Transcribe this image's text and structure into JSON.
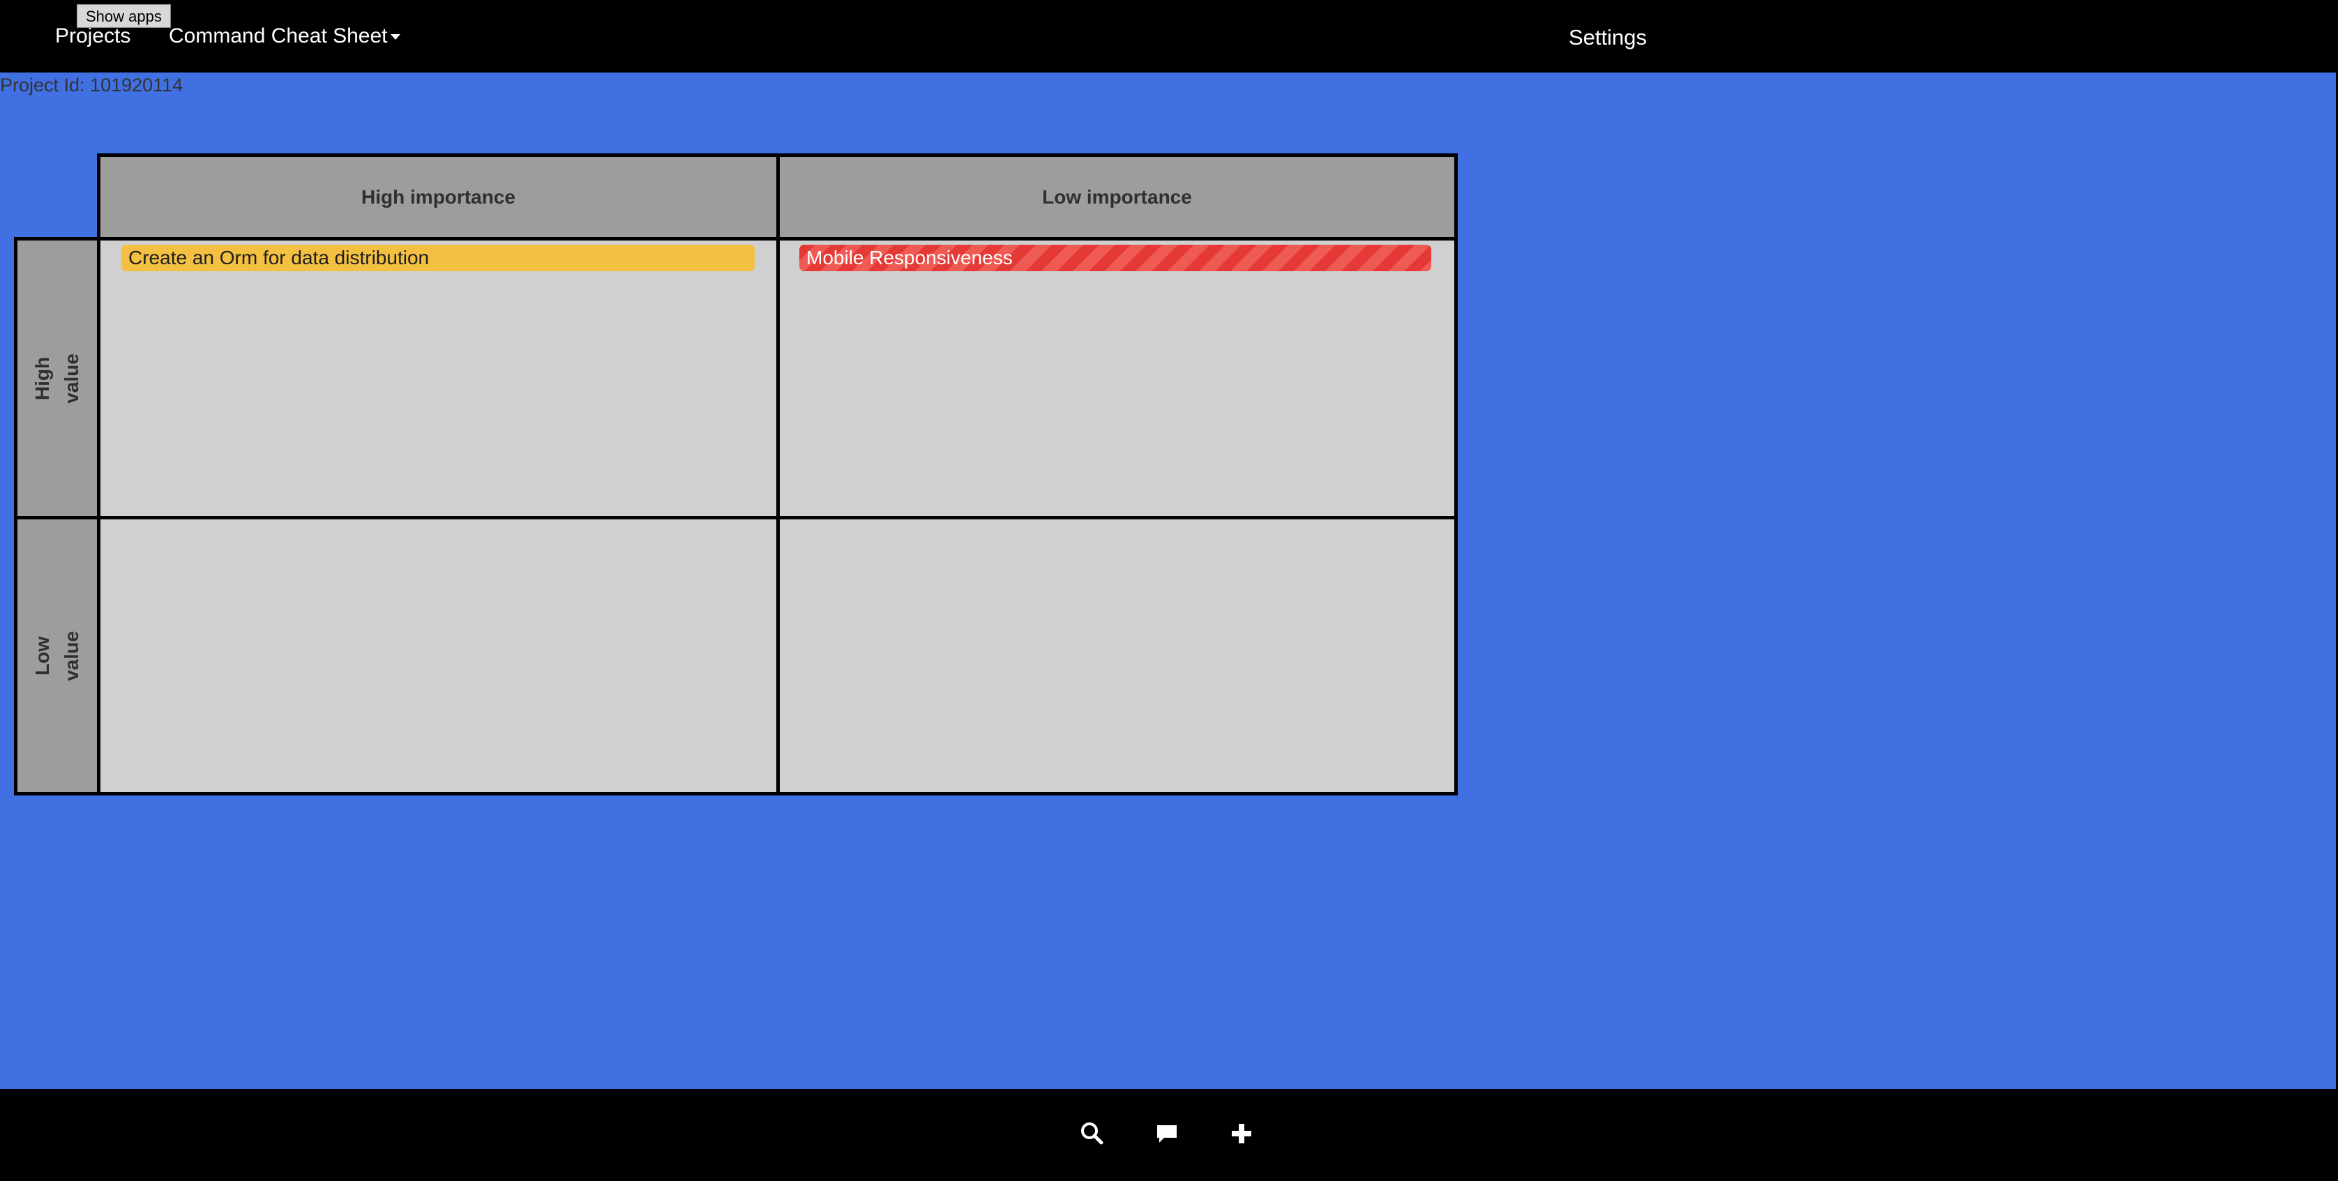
{
  "topbar": {
    "show_apps_label": "Show apps",
    "projects_label": "Projects",
    "cheat_sheet_label": "Command Cheat Sheet",
    "settings_label": "Settings"
  },
  "project": {
    "id_text": "Project Id: 101920114"
  },
  "matrix": {
    "columns": [
      {
        "label": "High importance"
      },
      {
        "label": "Low importance"
      }
    ],
    "rows": [
      {
        "label_line1": "High",
        "label_line2": "value"
      },
      {
        "label_line1": "Low",
        "label_line2": "value"
      }
    ],
    "tasks": [
      {
        "title": "Create an Orm for data distribution",
        "color": "#f4c042",
        "quadrant": "high-value-high-importance"
      },
      {
        "title": "Mobile Responsiveness",
        "color": "#e53935",
        "quadrant": "high-value-low-importance"
      }
    ]
  },
  "bottombar": {
    "icons": [
      "search-icon",
      "comment-icon",
      "plus-icon"
    ]
  },
  "colors": {
    "background": "#4170e2",
    "bars": "#000000",
    "header_cell": "#9d9d9d",
    "quadrant": "#d0d0d0"
  }
}
